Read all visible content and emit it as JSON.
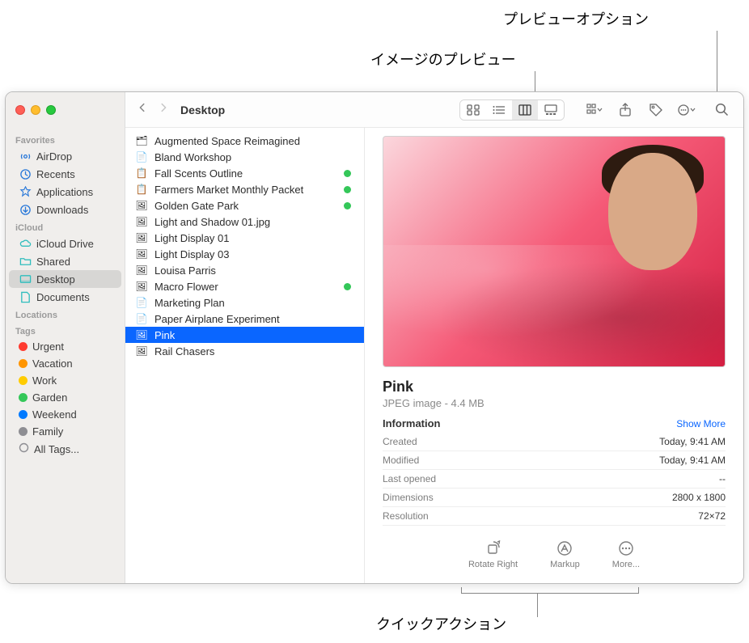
{
  "callouts": {
    "preview_image": "イメージのプレビュー",
    "preview_options": "プレビューオプション",
    "quick_actions": "クイックアクション"
  },
  "window": {
    "title": "Desktop"
  },
  "sidebar": {
    "sections": {
      "favorites": {
        "label": "Favorites",
        "items": [
          {
            "label": "AirDrop",
            "icon": "airdrop"
          },
          {
            "label": "Recents",
            "icon": "clock"
          },
          {
            "label": "Applications",
            "icon": "apps"
          },
          {
            "label": "Downloads",
            "icon": "download"
          }
        ]
      },
      "icloud": {
        "label": "iCloud",
        "items": [
          {
            "label": "iCloud Drive",
            "icon": "cloud"
          },
          {
            "label": "Shared",
            "icon": "folder"
          },
          {
            "label": "Desktop",
            "icon": "desktop",
            "selected": true
          },
          {
            "label": "Documents",
            "icon": "doc"
          }
        ]
      },
      "locations": {
        "label": "Locations"
      },
      "tags": {
        "label": "Tags",
        "items": [
          {
            "label": "Urgent",
            "color": "#ff3b30"
          },
          {
            "label": "Vacation",
            "color": "#ff9500"
          },
          {
            "label": "Work",
            "color": "#ffcc00"
          },
          {
            "label": "Garden",
            "color": "#34c759"
          },
          {
            "label": "Weekend",
            "color": "#007aff"
          },
          {
            "label": "Family",
            "color": "#8e8e93"
          },
          {
            "label": "All Tags...",
            "color": null,
            "all": true
          }
        ]
      }
    }
  },
  "files": [
    {
      "name": "Augmented Space Reimagined",
      "icon": "🗂"
    },
    {
      "name": "Bland Workshop",
      "icon": "📄"
    },
    {
      "name": "Fall Scents Outline",
      "icon": "📋",
      "tagged": true
    },
    {
      "name": "Farmers Market Monthly Packet",
      "icon": "📋",
      "tagged": true
    },
    {
      "name": "Golden Gate Park",
      "icon": "🖼",
      "tagged": true
    },
    {
      "name": "Light and Shadow 01.jpg",
      "icon": "🖼"
    },
    {
      "name": "Light Display 01",
      "icon": "🖼"
    },
    {
      "name": "Light Display 03",
      "icon": "🖼"
    },
    {
      "name": "Louisa Parris",
      "icon": "🖼"
    },
    {
      "name": "Macro Flower",
      "icon": "🖼",
      "tagged": true
    },
    {
      "name": "Marketing Plan",
      "icon": "📄"
    },
    {
      "name": "Paper Airplane Experiment",
      "icon": "📄"
    },
    {
      "name": "Pink",
      "icon": "🖼",
      "selected": true
    },
    {
      "name": "Rail Chasers",
      "icon": "🖼"
    }
  ],
  "preview": {
    "title": "Pink",
    "subtitle": "JPEG image - 4.4 MB",
    "info_label": "Information",
    "show_more": "Show More",
    "rows": [
      {
        "k": "Created",
        "v": "Today, 9:41 AM"
      },
      {
        "k": "Modified",
        "v": "Today, 9:41 AM"
      },
      {
        "k": "Last opened",
        "v": "--"
      },
      {
        "k": "Dimensions",
        "v": "2800 x 1800"
      },
      {
        "k": "Resolution",
        "v": "72×72"
      }
    ],
    "quick_actions": [
      {
        "label": "Rotate Right",
        "icon": "rotate"
      },
      {
        "label": "Markup",
        "icon": "markup"
      },
      {
        "label": "More...",
        "icon": "more"
      }
    ]
  }
}
